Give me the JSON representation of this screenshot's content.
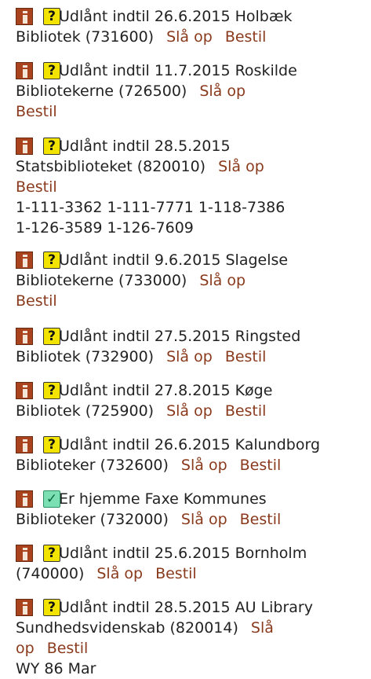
{
  "icons": {
    "info": "info-icon",
    "unknown": "question-mark-icon",
    "available": "checkmark-icon"
  },
  "colors": {
    "link": "#8a3a1c",
    "info_icon": "#a9431e",
    "unknown_icon": "#f2e400",
    "available_icon": "#7ae0b4"
  },
  "holdings": [
    {
      "status_glyph": "?",
      "l1": "Udlånt indtil 26.6.2015 Holbæk",
      "l2": "Bibliotek (731600)",
      "look": "Slå op",
      "order": "Bestil"
    },
    {
      "status_glyph": "?",
      "l1": "Udlånt indtil 11.7.2015 Roskilde",
      "l2": "Bibliotekerne (726500)",
      "look": "Slå op",
      "order": "Bestil"
    },
    {
      "status_glyph": "?",
      "l1": "Udlånt indtil 28.5.2015",
      "l2": "Statsbiblioteket (820010)",
      "look": "Slå op",
      "order": "Bestil",
      "copies1": "1-111-3362 1-111-7771 1-118-7386",
      "copies2": "1-126-3589 1-126-7609"
    },
    {
      "status_glyph": "?",
      "l1": "Udlånt indtil 9.6.2015 Slagelse",
      "l2": "Bibliotekerne (733000)",
      "look": "Slå op",
      "order": "Bestil"
    },
    {
      "status_glyph": "?",
      "l1": "Udlånt indtil 27.5.2015 Ringsted",
      "l2": "Bibliotek (732900)",
      "look": "Slå op",
      "order": "Bestil"
    },
    {
      "status_glyph": "?",
      "l1": "Udlånt indtil 27.8.2015 Køge",
      "l2": "Bibliotek (725900)",
      "look": "Slå op",
      "order": "Bestil"
    },
    {
      "status_glyph": "?",
      "l1": "Udlånt indtil 26.6.2015 Kalundborg",
      "l2": "Biblioteker (732600)",
      "look": "Slå op",
      "order": "Bestil"
    },
    {
      "status_glyph": "✓",
      "l1": "Er hjemme Faxe Kommunes",
      "l2": "Biblioteker (732000)",
      "look": "Slå op",
      "order": "Bestil"
    },
    {
      "status_glyph": "?",
      "l1": "Udlånt indtil 25.6.2015 Bornholm",
      "l2": "(740000)",
      "look": "Slå op",
      "order": "Bestil"
    },
    {
      "status_glyph": "?",
      "l1": "Udlånt indtil 28.5.2015 AU Library",
      "l2": "Sundhedsvidenskab (820014)",
      "look_a": "Slå",
      "look_b": "op",
      "order": "Bestil",
      "copies1": "WY 86 Mar"
    }
  ]
}
